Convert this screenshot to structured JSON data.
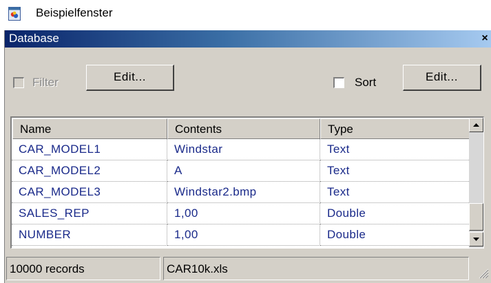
{
  "window": {
    "title": "Beispielfenster",
    "icon": "app-window-icon"
  },
  "panel": {
    "caption": "Database",
    "close_glyph": "×"
  },
  "toolbar": {
    "filter_label": "Filter",
    "filter_checked": false,
    "filter_enabled": false,
    "filter_edit_label": "Edit...",
    "sort_label": "Sort",
    "sort_checked": false,
    "sort_edit_label": "Edit..."
  },
  "grid": {
    "columns": [
      "Name",
      "Contents",
      "Type"
    ],
    "rows": [
      {
        "name": "CAR_MODEL1",
        "contents": "Windstar",
        "type": "Text"
      },
      {
        "name": "CAR_MODEL2",
        "contents": "A",
        "type": "Text"
      },
      {
        "name": "CAR_MODEL3",
        "contents": "Windstar2.bmp",
        "type": "Text"
      },
      {
        "name": "SALES_REP",
        "contents": "1,00",
        "type": "Double"
      },
      {
        "name": "NUMBER",
        "contents": "1,00",
        "type": "Double"
      }
    ]
  },
  "status": {
    "records": "10000 records",
    "file": "CAR10k.xls"
  },
  "colors": {
    "caption_start": "#0a246a",
    "caption_end": "#a6caf0",
    "panel_bg": "#d4d0c8",
    "cell_text": "#1a2a8a"
  }
}
